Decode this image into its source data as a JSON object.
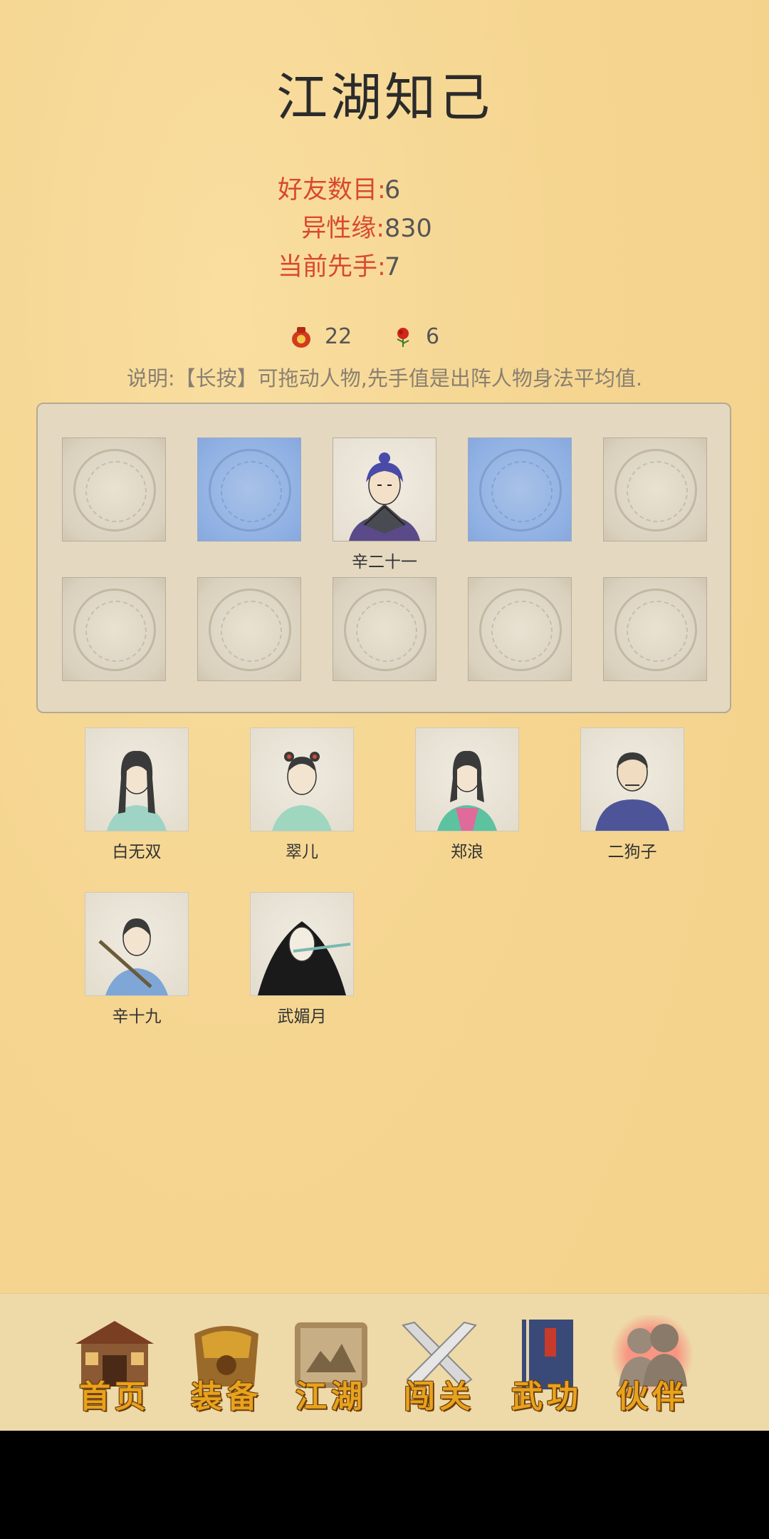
{
  "page": {
    "title": "江湖知己"
  },
  "stats": [
    {
      "label": "好友数目:",
      "value": "6"
    },
    {
      "label": "异性缘:",
      "value": "830"
    },
    {
      "label": "当前先手:",
      "value": "7"
    }
  ],
  "resources": {
    "wine": {
      "icon": "wine-jar-icon",
      "value": "22"
    },
    "rose": {
      "icon": "rose-icon",
      "value": "6"
    }
  },
  "note": "说明:【长按】可拖动人物,先手值是出阵人物身法平均值.",
  "formation": {
    "row1": [
      {
        "state": "empty"
      },
      {
        "state": "highlight"
      },
      {
        "state": "hero",
        "name": "辛二十一"
      },
      {
        "state": "highlight"
      },
      {
        "state": "empty"
      }
    ],
    "row2": [
      {
        "state": "empty"
      },
      {
        "state": "empty"
      },
      {
        "state": "empty"
      },
      {
        "state": "empty"
      },
      {
        "state": "empty"
      }
    ]
  },
  "friends": [
    {
      "name": "白无双"
    },
    {
      "name": "翠儿"
    },
    {
      "name": "郑浪"
    },
    {
      "name": "二狗子"
    },
    {
      "name": "辛十九"
    },
    {
      "name": "武媚月"
    }
  ],
  "nav": [
    {
      "label": "首页",
      "icon": "house-icon"
    },
    {
      "label": "装备",
      "icon": "armor-icon"
    },
    {
      "label": "江湖",
      "icon": "scroll-icon"
    },
    {
      "label": "闯关",
      "icon": "crossed-swords-icon"
    },
    {
      "label": "武功",
      "icon": "book-icon"
    },
    {
      "label": "伙伴",
      "icon": "partners-icon",
      "active": true
    }
  ],
  "colors": {
    "accent": "#d9492e",
    "highlight_slot": "#8fb0e3",
    "nav_label": "#e8a21c"
  }
}
